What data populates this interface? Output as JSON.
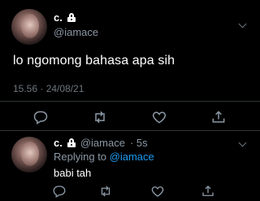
{
  "tweet": {
    "display_name": "c.",
    "handle": "@iamace",
    "text": "lo ngomong bahasa apa sih",
    "timestamp": "15.56 · 24/08/21"
  },
  "reply": {
    "display_name": "c.",
    "handle": "@iamace",
    "age": "· 5s",
    "replying_prefix": "Replying to ",
    "replying_to": "@iamace",
    "text": "babi tah"
  },
  "colors": {
    "background": "#000000",
    "secondary_text": "#8b98a5",
    "link": "#1d9bf0",
    "divider": "#2f3336"
  },
  "icons": [
    "lock-icon",
    "chevron-down-icon",
    "reply-icon",
    "retweet-icon",
    "like-icon",
    "share-icon"
  ]
}
